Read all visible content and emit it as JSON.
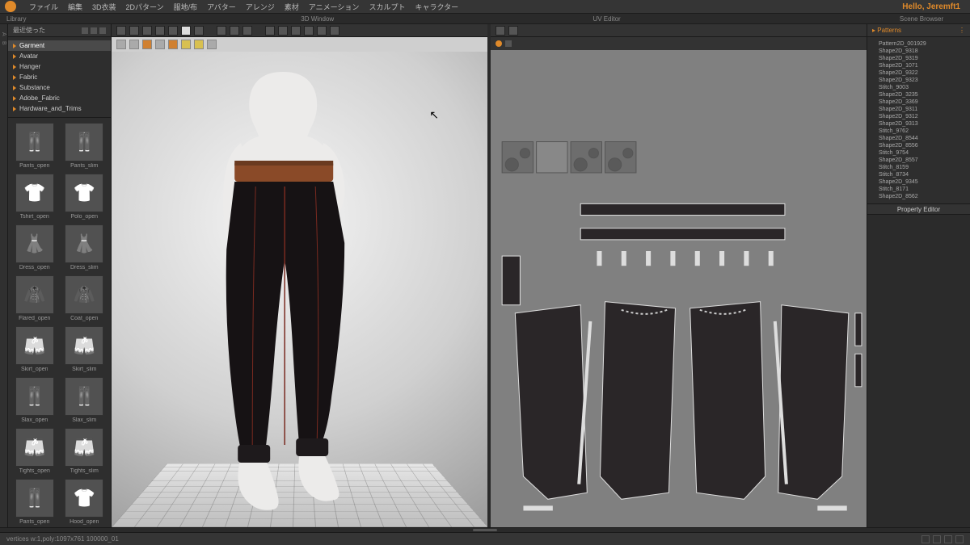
{
  "menu": {
    "items": [
      "ファイル",
      "編集",
      "3D衣装",
      "2Dパターン",
      "服地/布",
      "アバター",
      "アレンジ",
      "素材",
      "アニメーション",
      "スカルプト",
      "キャラクター"
    ],
    "hello_prefix": "Hello, ",
    "hello_user": "Jeremft1"
  },
  "tabs": {
    "left": "Library",
    "center": "3D Window",
    "right": "UV Editor",
    "farRight": "Scene Browser"
  },
  "sidebar": {
    "header": "最近使った",
    "folders": [
      {
        "label": "Garment",
        "selected": true
      },
      {
        "label": "Avatar"
      },
      {
        "label": "Hanger"
      },
      {
        "label": "Fabric"
      },
      {
        "label": "Substance"
      },
      {
        "label": "Adobe_Fabric"
      },
      {
        "label": "Hardware_and_Trims"
      }
    ],
    "thumbs": [
      {
        "label": "Pants_open"
      },
      {
        "label": "Pants_slim"
      },
      {
        "label": "Tshirt_open"
      },
      {
        "label": "Polo_open"
      },
      {
        "label": "Dress_open"
      },
      {
        "label": "Dress_slim"
      },
      {
        "label": "Flared_open"
      },
      {
        "label": "Coat_open"
      },
      {
        "label": "Skirt_open"
      },
      {
        "label": "Skirt_slim"
      },
      {
        "label": "Slax_open"
      },
      {
        "label": "Slax_slim"
      },
      {
        "label": "Tights_open"
      },
      {
        "label": "Tights_slim"
      },
      {
        "label": "Pants_open"
      },
      {
        "label": "Hood_open"
      }
    ]
  },
  "scene": {
    "root": "Patterns",
    "items": [
      "Pattern2D_001929",
      "Shape2D_9318",
      "Shape2D_9319",
      "Shape2D_1071",
      "Shape2D_9322",
      "Shape2D_9323",
      "Stitch_9003",
      "Shape2D_3235",
      "Shape2D_3369",
      "Shape2D_9311",
      "Shape2D_9312",
      "Shape2D_9313",
      "Stitch_9762",
      "Shape2D_8544",
      "Shape2D_8556",
      "Stitch_9754",
      "Shape2D_8557",
      "Stitch_8159",
      "Stitch_8734",
      "Shape2D_9345",
      "Stitch_8171",
      "Shape2D_8562"
    ],
    "property_title": "Property Editor"
  },
  "status": {
    "left": "vertices   w:1,poly:1097x761   100000_01"
  },
  "colors": {
    "accent": "#e08a2a",
    "waistband": "#8a4a28",
    "pants": "#161214"
  }
}
